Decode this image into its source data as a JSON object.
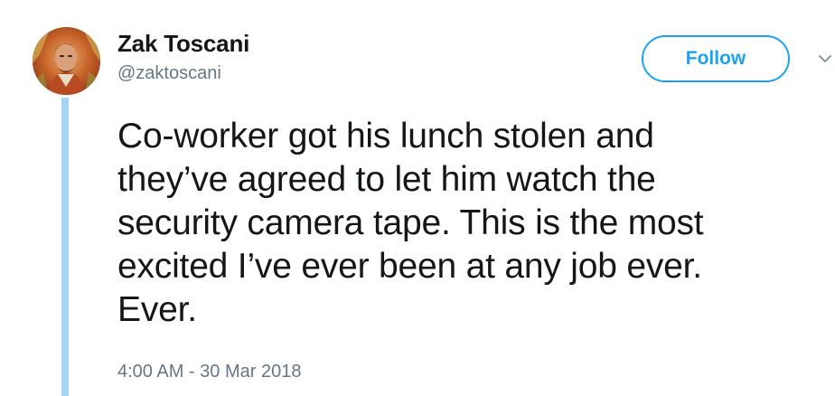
{
  "author": {
    "name": "Zak Toscani",
    "handle": "@zaktoscani",
    "avatar_icon": "user-avatar-photo"
  },
  "follow_button": {
    "label": "Follow",
    "color": "#1da1f2"
  },
  "menu_caret_icon": "chevron-down-icon",
  "tweet": {
    "lines": [
      "Co-worker got his lunch stolen and",
      "they’ve agreed to let him watch the",
      "security camera tape. This is the most",
      "excited I’ve ever been at any job ever.",
      "Ever."
    ],
    "timestamp": "4:00 AM - 30 Mar 2018"
  },
  "colors": {
    "text": "#14171a",
    "secondary": "#657786",
    "thread_line": "#a9d3f2",
    "accent": "#1da1f2"
  }
}
